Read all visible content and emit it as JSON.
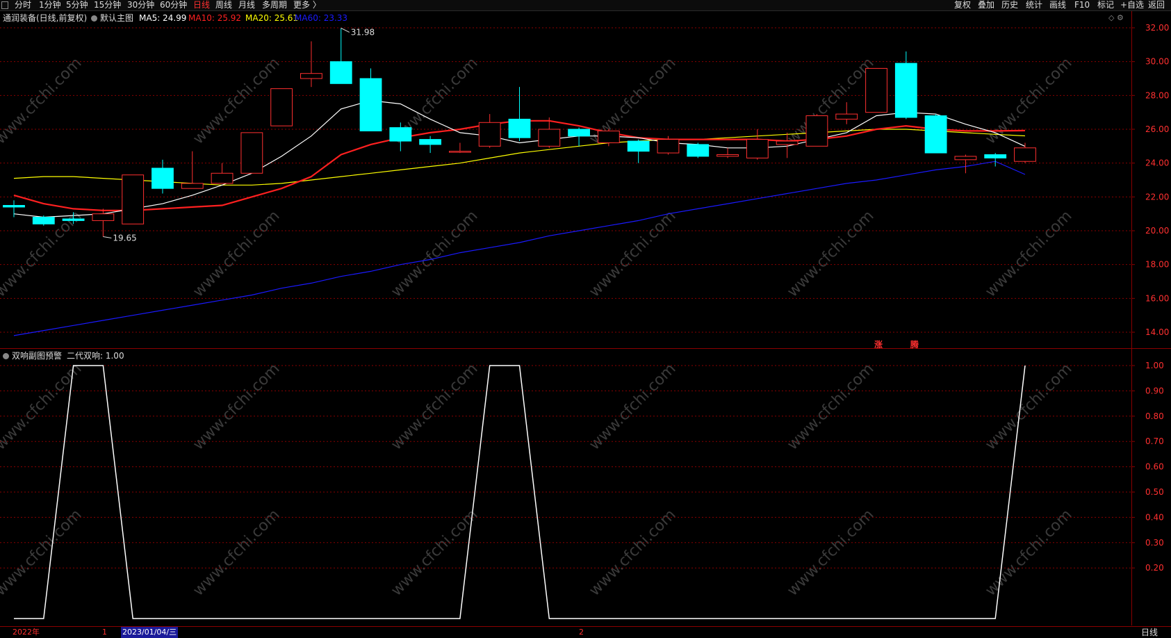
{
  "toolbar": {
    "timeframes": [
      "分时",
      "1分钟",
      "5分钟",
      "15分钟",
      "30分钟",
      "60分钟",
      "日线",
      "周线",
      "月线",
      "多周期",
      "更多 〉"
    ],
    "active_timeframe": "日线",
    "right_buttons": [
      "复权",
      "叠加",
      "历史",
      "统计",
      "画线",
      "F10",
      "标记",
      "+自选",
      "返回"
    ]
  },
  "main_panel": {
    "stock_title": "通润装备(日线,前复权)",
    "template_label": "默认主图",
    "ma": [
      {
        "label": "MA5: 24.99",
        "color": "#ffffff"
      },
      {
        "label": "MA10: 25.92",
        "color": "#ff2020"
      },
      {
        "label": "MA20: 25.61",
        "color": "#ffff00"
      },
      {
        "label": "MA60: 23.33",
        "color": "#1a1aff"
      }
    ],
    "high_marker": "31.98",
    "low_marker": "19.65",
    "event_labels": [
      "涨",
      "腾"
    ]
  },
  "sub_panel": {
    "title": "双响副图预警",
    "value_label": "二代双响: 1.00"
  },
  "bottom_bar": {
    "year_label": "2022年",
    "marker_1": "1",
    "cursor_date": "2023/01/04/三",
    "marker_2": "2",
    "period_label": "日线"
  },
  "watermark": "www.cfchi.com",
  "colors": {
    "up": "#ff3030",
    "down": "#00ffff",
    "grid": "#8b0000",
    "ma5": "#ffffff",
    "ma10": "#ff2020",
    "ma20": "#ffff00",
    "ma60": "#1a1aff"
  },
  "chart_data": [
    {
      "type": "candlestick",
      "y_axis_ticks": [
        "32.00",
        "30.00",
        "28.00",
        "26.00",
        "24.00",
        "22.00",
        "20.00",
        "18.00",
        "16.00",
        "14.00"
      ],
      "ylim": [
        13.2,
        32.6
      ],
      "candles": [
        {
          "o": 21.5,
          "c": 21.4,
          "h": 21.8,
          "l": 20.8
        },
        {
          "o": 20.8,
          "c": 20.4,
          "h": 20.9,
          "l": 20.3
        },
        {
          "o": 20.7,
          "c": 20.6,
          "h": 21.1,
          "l": 20.4
        },
        {
          "o": 20.6,
          "c": 21.0,
          "h": 21.3,
          "l": 19.65
        },
        {
          "o": 20.4,
          "c": 23.3,
          "h": 23.3,
          "l": 20.4
        },
        {
          "o": 23.7,
          "c": 22.5,
          "h": 24.2,
          "l": 22.2
        },
        {
          "o": 22.5,
          "c": 22.8,
          "h": 24.7,
          "l": 22.5
        },
        {
          "o": 22.8,
          "c": 23.4,
          "h": 24.0,
          "l": 22.8
        },
        {
          "o": 23.4,
          "c": 25.8,
          "h": 25.8,
          "l": 23.4
        },
        {
          "o": 26.2,
          "c": 28.4,
          "h": 28.4,
          "l": 26.2
        },
        {
          "o": 29.0,
          "c": 29.3,
          "h": 31.2,
          "l": 28.5
        },
        {
          "o": 30.0,
          "c": 28.7,
          "h": 31.98,
          "l": 28.7
        },
        {
          "o": 29.0,
          "c": 25.9,
          "h": 29.6,
          "l": 25.9
        },
        {
          "o": 26.1,
          "c": 25.3,
          "h": 26.4,
          "l": 24.7
        },
        {
          "o": 25.4,
          "c": 25.1,
          "h": 25.6,
          "l": 24.6
        },
        {
          "o": 24.7,
          "c": 24.7,
          "h": 25.2,
          "l": 24.6
        },
        {
          "o": 25.0,
          "c": 26.4,
          "h": 26.9,
          "l": 24.9
        },
        {
          "o": 26.6,
          "c": 25.5,
          "h": 28.5,
          "l": 25.3
        },
        {
          "o": 25.0,
          "c": 26.0,
          "h": 26.7,
          "l": 24.9
        },
        {
          "o": 26.0,
          "c": 25.6,
          "h": 26.1,
          "l": 25.0
        },
        {
          "o": 25.2,
          "c": 25.9,
          "h": 26.0,
          "l": 25.0
        },
        {
          "o": 25.3,
          "c": 24.7,
          "h": 25.4,
          "l": 24.0
        },
        {
          "o": 24.6,
          "c": 25.4,
          "h": 25.6,
          "l": 24.5
        },
        {
          "o": 25.1,
          "c": 24.4,
          "h": 25.2,
          "l": 24.3
        },
        {
          "o": 24.4,
          "c": 24.5,
          "h": 24.9,
          "l": 24.3
        },
        {
          "o": 24.3,
          "c": 25.4,
          "h": 26.0,
          "l": 24.2
        },
        {
          "o": 25.1,
          "c": 25.3,
          "h": 25.8,
          "l": 24.3
        },
        {
          "o": 25.0,
          "c": 26.8,
          "h": 26.9,
          "l": 25.0
        },
        {
          "o": 26.6,
          "c": 26.9,
          "h": 27.6,
          "l": 26.3
        },
        {
          "o": 27.0,
          "c": 29.6,
          "h": 29.6,
          "l": 27.0
        },
        {
          "o": 29.9,
          "c": 26.7,
          "h": 30.6,
          "l": 26.6
        },
        {
          "o": 26.8,
          "c": 24.6,
          "h": 26.9,
          "l": 24.6
        },
        {
          "o": 24.2,
          "c": 24.4,
          "h": 24.5,
          "l": 23.4
        },
        {
          "o": 24.5,
          "c": 24.3,
          "h": 24.6,
          "l": 23.8
        },
        {
          "o": 24.1,
          "c": 24.9,
          "h": 25.2,
          "l": 24.0
        }
      ],
      "series": [
        {
          "name": "MA5",
          "values": [
            21.0,
            20.8,
            20.9,
            21.0,
            21.3,
            21.6,
            22.1,
            22.7,
            23.4,
            24.4,
            25.6,
            27.2,
            27.7,
            27.5,
            26.6,
            25.8,
            25.6,
            25.2,
            25.4,
            25.6,
            25.6,
            25.5,
            25.2,
            25.1,
            24.9,
            24.9,
            25.0,
            25.4,
            25.8,
            26.8,
            27.0,
            26.9,
            26.3,
            25.8,
            24.99
          ]
        },
        {
          "name": "MA10",
          "values": [
            22.1,
            21.6,
            21.3,
            21.2,
            21.2,
            21.3,
            21.4,
            21.5,
            22.0,
            22.5,
            23.2,
            24.5,
            25.1,
            25.5,
            25.8,
            26.0,
            26.3,
            26.5,
            26.5,
            26.2,
            25.8,
            25.5,
            25.4,
            25.4,
            25.4,
            25.4,
            25.3,
            25.4,
            25.6,
            26.0,
            26.2,
            26.0,
            25.9,
            25.9,
            25.92
          ]
        },
        {
          "name": "MA20",
          "values": [
            23.1,
            23.2,
            23.2,
            23.1,
            23.0,
            22.9,
            22.8,
            22.7,
            22.7,
            22.8,
            23.0,
            23.2,
            23.4,
            23.6,
            23.8,
            24.0,
            24.3,
            24.6,
            24.8,
            25.0,
            25.2,
            25.3,
            25.4,
            25.4,
            25.5,
            25.6,
            25.7,
            25.8,
            25.9,
            26.0,
            26.0,
            25.9,
            25.8,
            25.7,
            25.61
          ]
        },
        {
          "name": "MA60",
          "values": [
            13.8,
            14.1,
            14.4,
            14.7,
            15.0,
            15.3,
            15.6,
            15.9,
            16.2,
            16.6,
            16.9,
            17.3,
            17.6,
            18.0,
            18.3,
            18.7,
            19.0,
            19.3,
            19.7,
            20.0,
            20.3,
            20.6,
            21.0,
            21.3,
            21.6,
            21.9,
            22.2,
            22.5,
            22.8,
            23.0,
            23.3,
            23.6,
            23.8,
            24.1,
            23.33
          ]
        }
      ]
    },
    {
      "type": "line",
      "name": "二代双响",
      "y_axis_ticks": [
        "1.00",
        "0.90",
        "0.80",
        "0.70",
        "0.60",
        "0.50",
        "0.40",
        "0.30",
        "0.20"
      ],
      "ylim": [
        0,
        1.0
      ],
      "values": [
        0,
        0,
        1,
        1,
        0,
        0,
        0,
        0,
        0,
        0,
        0,
        0,
        0,
        0,
        0,
        0,
        1,
        1,
        0,
        0,
        0,
        0,
        0,
        0,
        0,
        0,
        0,
        0,
        0,
        0,
        0,
        0,
        0,
        0,
        1
      ]
    }
  ]
}
